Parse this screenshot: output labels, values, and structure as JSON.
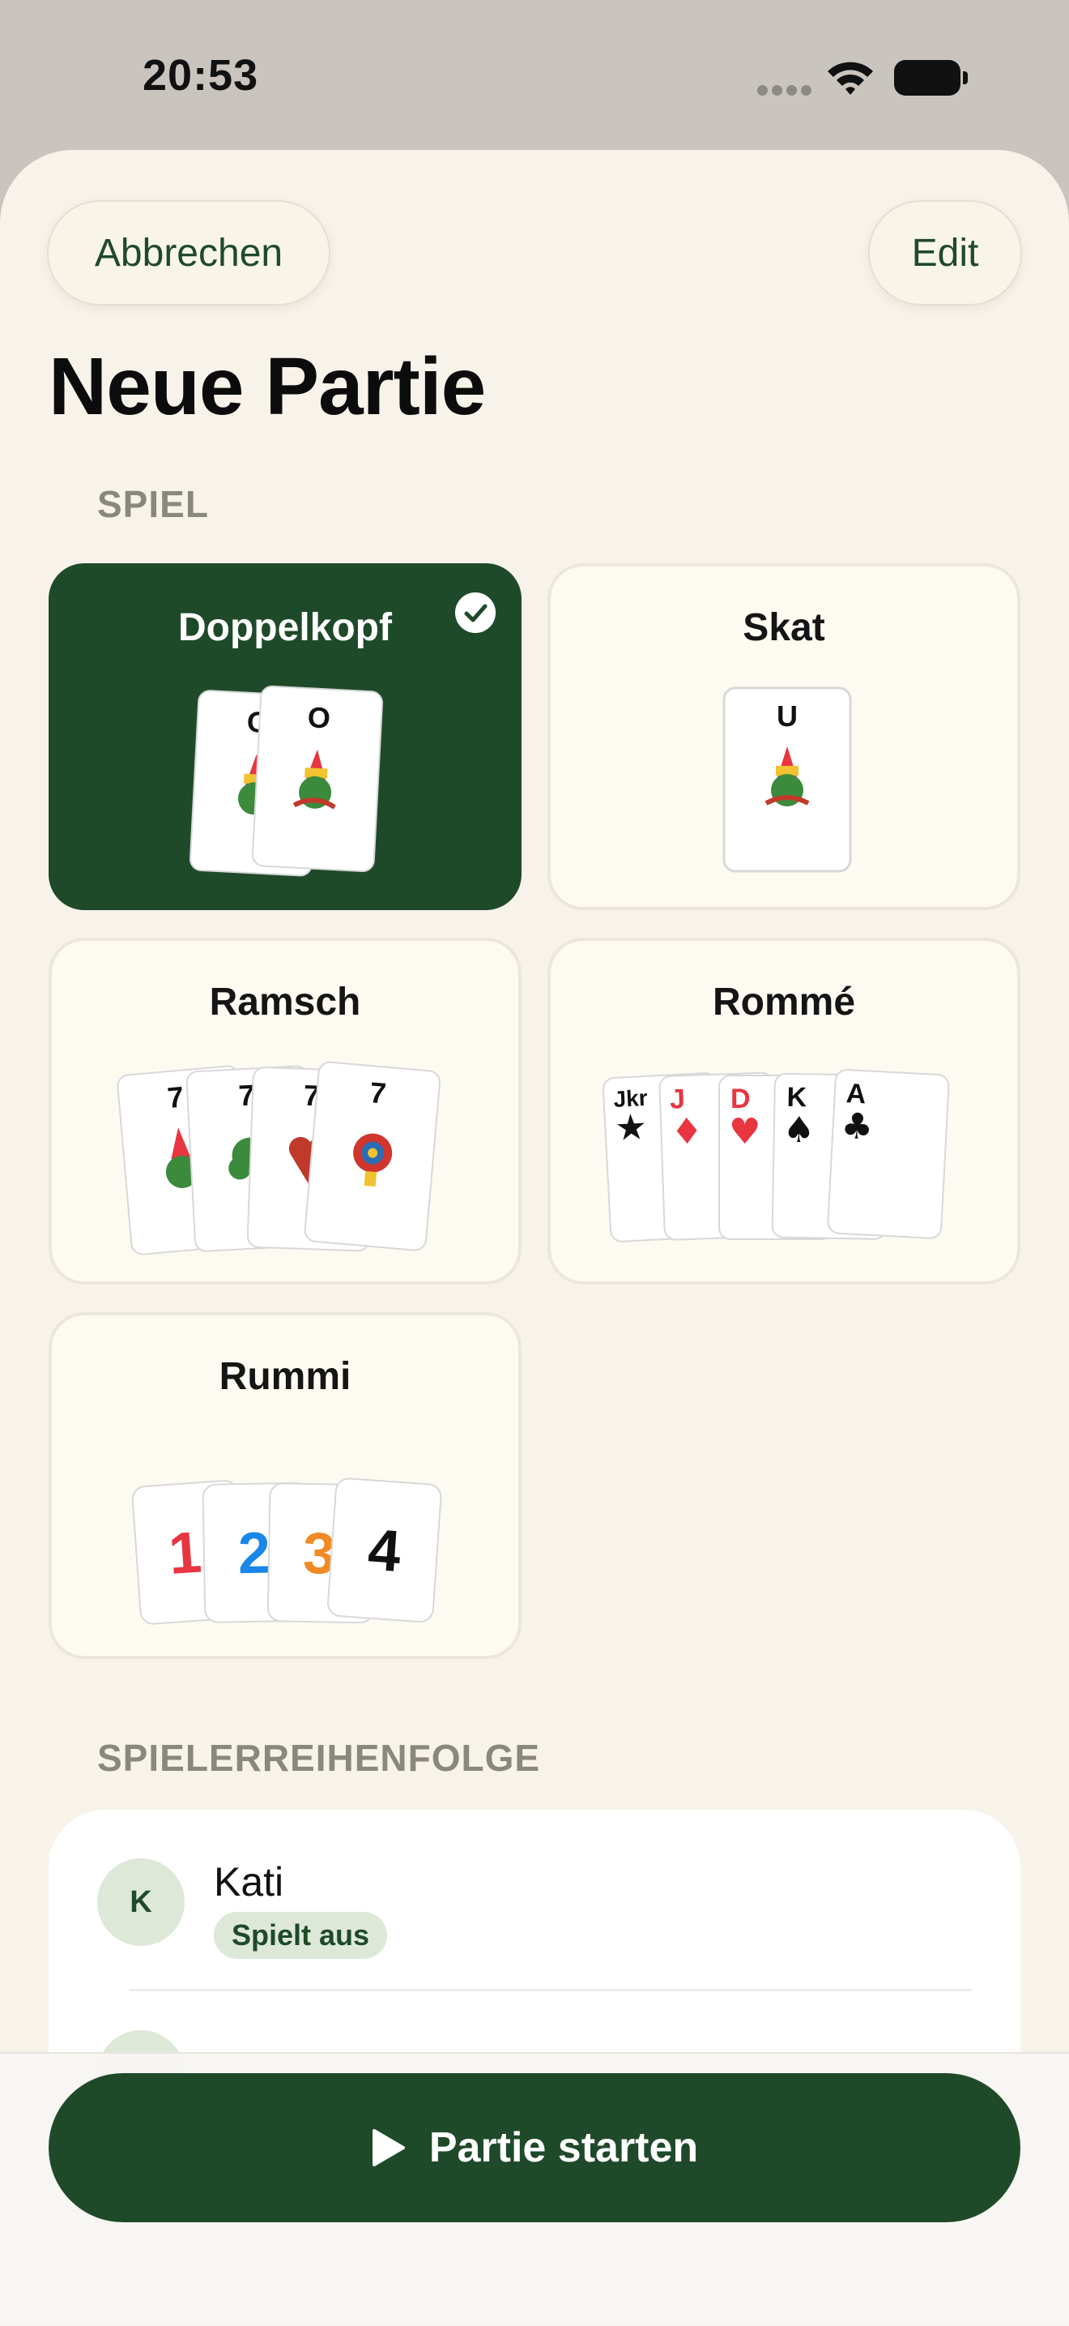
{
  "status": {
    "time": "20:53"
  },
  "header": {
    "cancel_label": "Abbrechen",
    "edit_label": "Edit",
    "title": "Neue Partie"
  },
  "sections": {
    "game": "SPIEL",
    "player_order": "SPIELERREIHENFOLGE"
  },
  "games": [
    {
      "name": "Doppelkopf",
      "selected": true,
      "card_ranks": [
        "O",
        "O"
      ]
    },
    {
      "name": "Skat",
      "selected": false,
      "card_ranks": [
        "U"
      ]
    },
    {
      "name": "Ramsch",
      "selected": false,
      "card_ranks": [
        "7",
        "7",
        "7",
        "7"
      ]
    },
    {
      "name": "Rommé",
      "selected": false,
      "card_ranks": [
        "Jkr",
        "J",
        "D",
        "K",
        "A"
      ]
    },
    {
      "name": "Rummi",
      "selected": false,
      "card_ranks": [
        "1",
        "2",
        "3",
        "4"
      ]
    }
  ],
  "players": [
    {
      "initial": "K",
      "name": "Kati",
      "badge": "Spielt aus"
    }
  ],
  "footer": {
    "start_label": "Partie starten"
  },
  "colors": {
    "accent": "#1f4a2a",
    "background": "#f7f3ea",
    "card_bg": "#fdfaf1",
    "red": "#e8353f",
    "blue": "#1a86e8",
    "orange": "#f08a24"
  }
}
